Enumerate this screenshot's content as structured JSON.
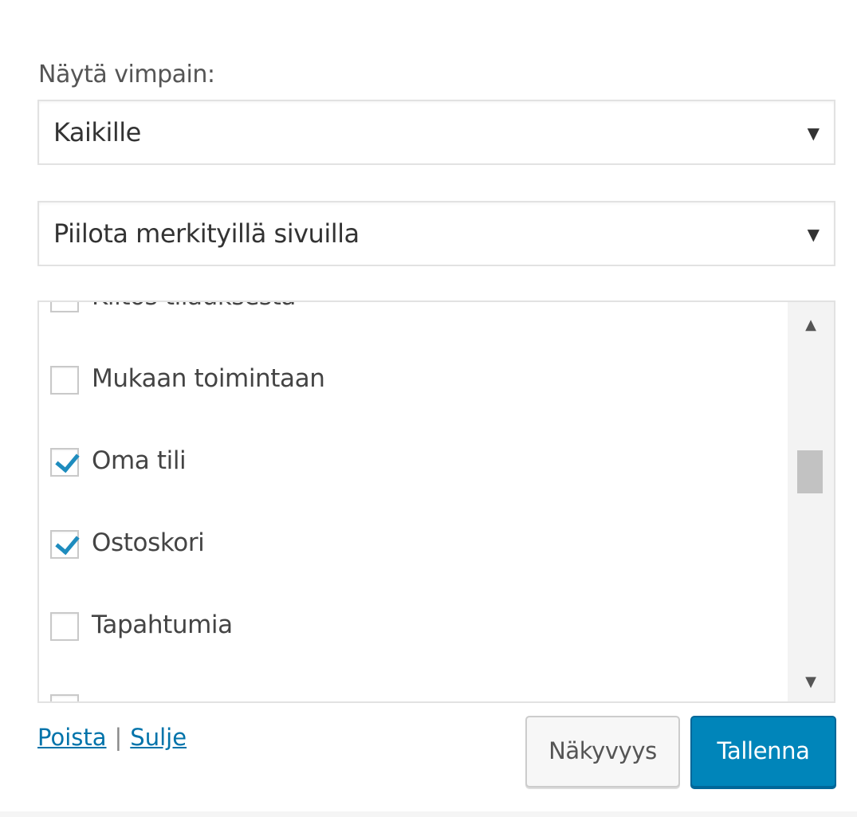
{
  "show_widget": {
    "label": "Näytä vimpain:",
    "selected": "Kaikille",
    "arrow_icon": "▼"
  },
  "visibility_mode": {
    "selected": "Piilota merkityillä sivuilla",
    "arrow_icon": "▼"
  },
  "pages": {
    "items": [
      {
        "label": "Kiitos tilauksesta",
        "checked": false
      },
      {
        "label": "Mukaan toimintaan",
        "checked": false
      },
      {
        "label": "Oma tili",
        "checked": true
      },
      {
        "label": "Ostoskori",
        "checked": true
      },
      {
        "label": "Tapahtumia",
        "checked": false
      },
      {
        "label": "",
        "checked": false
      }
    ],
    "scroll_up_icon": "▲",
    "scroll_down_icon": "▼"
  },
  "actions": {
    "delete_link": "Poista",
    "separator": "|",
    "close_link": "Sulje",
    "visibility_button": "Näkyvyys",
    "save_button": "Tallenna"
  },
  "colors": {
    "accent": "#0085ba",
    "link": "#0073aa",
    "check": "#1e8cbe"
  }
}
